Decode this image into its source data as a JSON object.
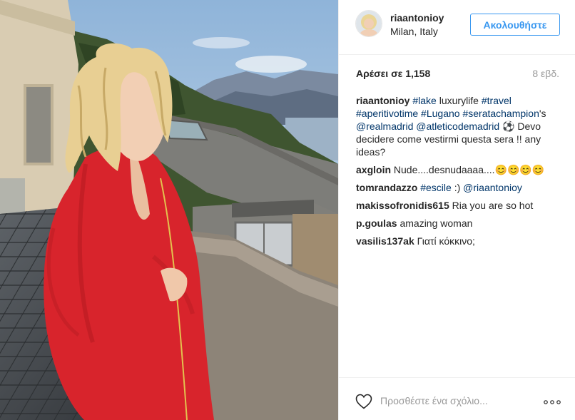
{
  "header": {
    "username": "riaantonioy",
    "location": "Milan, Italy",
    "follow_label": "Ακολουθήστε"
  },
  "stats": {
    "likes_label": "Αρέσει σε 1,158",
    "age": "8 εβδ."
  },
  "caption": {
    "user": "riaantonioy",
    "parts": [
      {
        "text": "#lake",
        "tag": true
      },
      {
        "text": " luxurylife ",
        "tag": false
      },
      {
        "text": "#travel",
        "tag": true
      },
      {
        "text": " ",
        "tag": false
      },
      {
        "text": "#aperitivotime",
        "tag": true
      },
      {
        "text": " ",
        "tag": false
      },
      {
        "text": "#Lugano",
        "tag": true
      },
      {
        "text": " ",
        "tag": false
      },
      {
        "text": "#seratachampion",
        "tag": true
      },
      {
        "text": "'s ",
        "tag": false
      },
      {
        "text": "@realmadrid",
        "tag": true
      },
      {
        "text": " ",
        "tag": false
      },
      {
        "text": "@atleticodemadrid",
        "tag": true
      },
      {
        "text": " ⚽ Devo decidere come vestirmi questa sera !! any ideas?",
        "tag": false
      }
    ]
  },
  "comments": [
    {
      "user": "axgloin",
      "parts": [
        {
          "text": "Nude....desnudaaaa....😊😊😊😊",
          "tag": false
        }
      ]
    },
    {
      "user": "tomrandazzo",
      "parts": [
        {
          "text": "#escile",
          "tag": true
        },
        {
          "text": " :) ",
          "tag": false
        },
        {
          "text": "@riaantonioy",
          "tag": true
        }
      ]
    },
    {
      "user": "makissofronidis615",
      "parts": [
        {
          "text": "Ria you are so hot",
          "tag": false
        }
      ]
    },
    {
      "user": "p.goulas",
      "parts": [
        {
          "text": "amazing woman",
          "tag": false
        }
      ]
    },
    {
      "user": "vasilis137ak",
      "parts": [
        {
          "text": "Γιατί κόκκινο;",
          "tag": false
        }
      ]
    }
  ],
  "footer": {
    "add_comment_placeholder": "Προσθέστε ένα σχόλιο...",
    "heart_icon": "heart-outline-icon",
    "more_icon": "more-options-icon"
  },
  "colors": {
    "accent": "#3897f0",
    "tag": "#003569",
    "text": "#262626",
    "muted": "#999999",
    "robe": "#d8242c"
  }
}
